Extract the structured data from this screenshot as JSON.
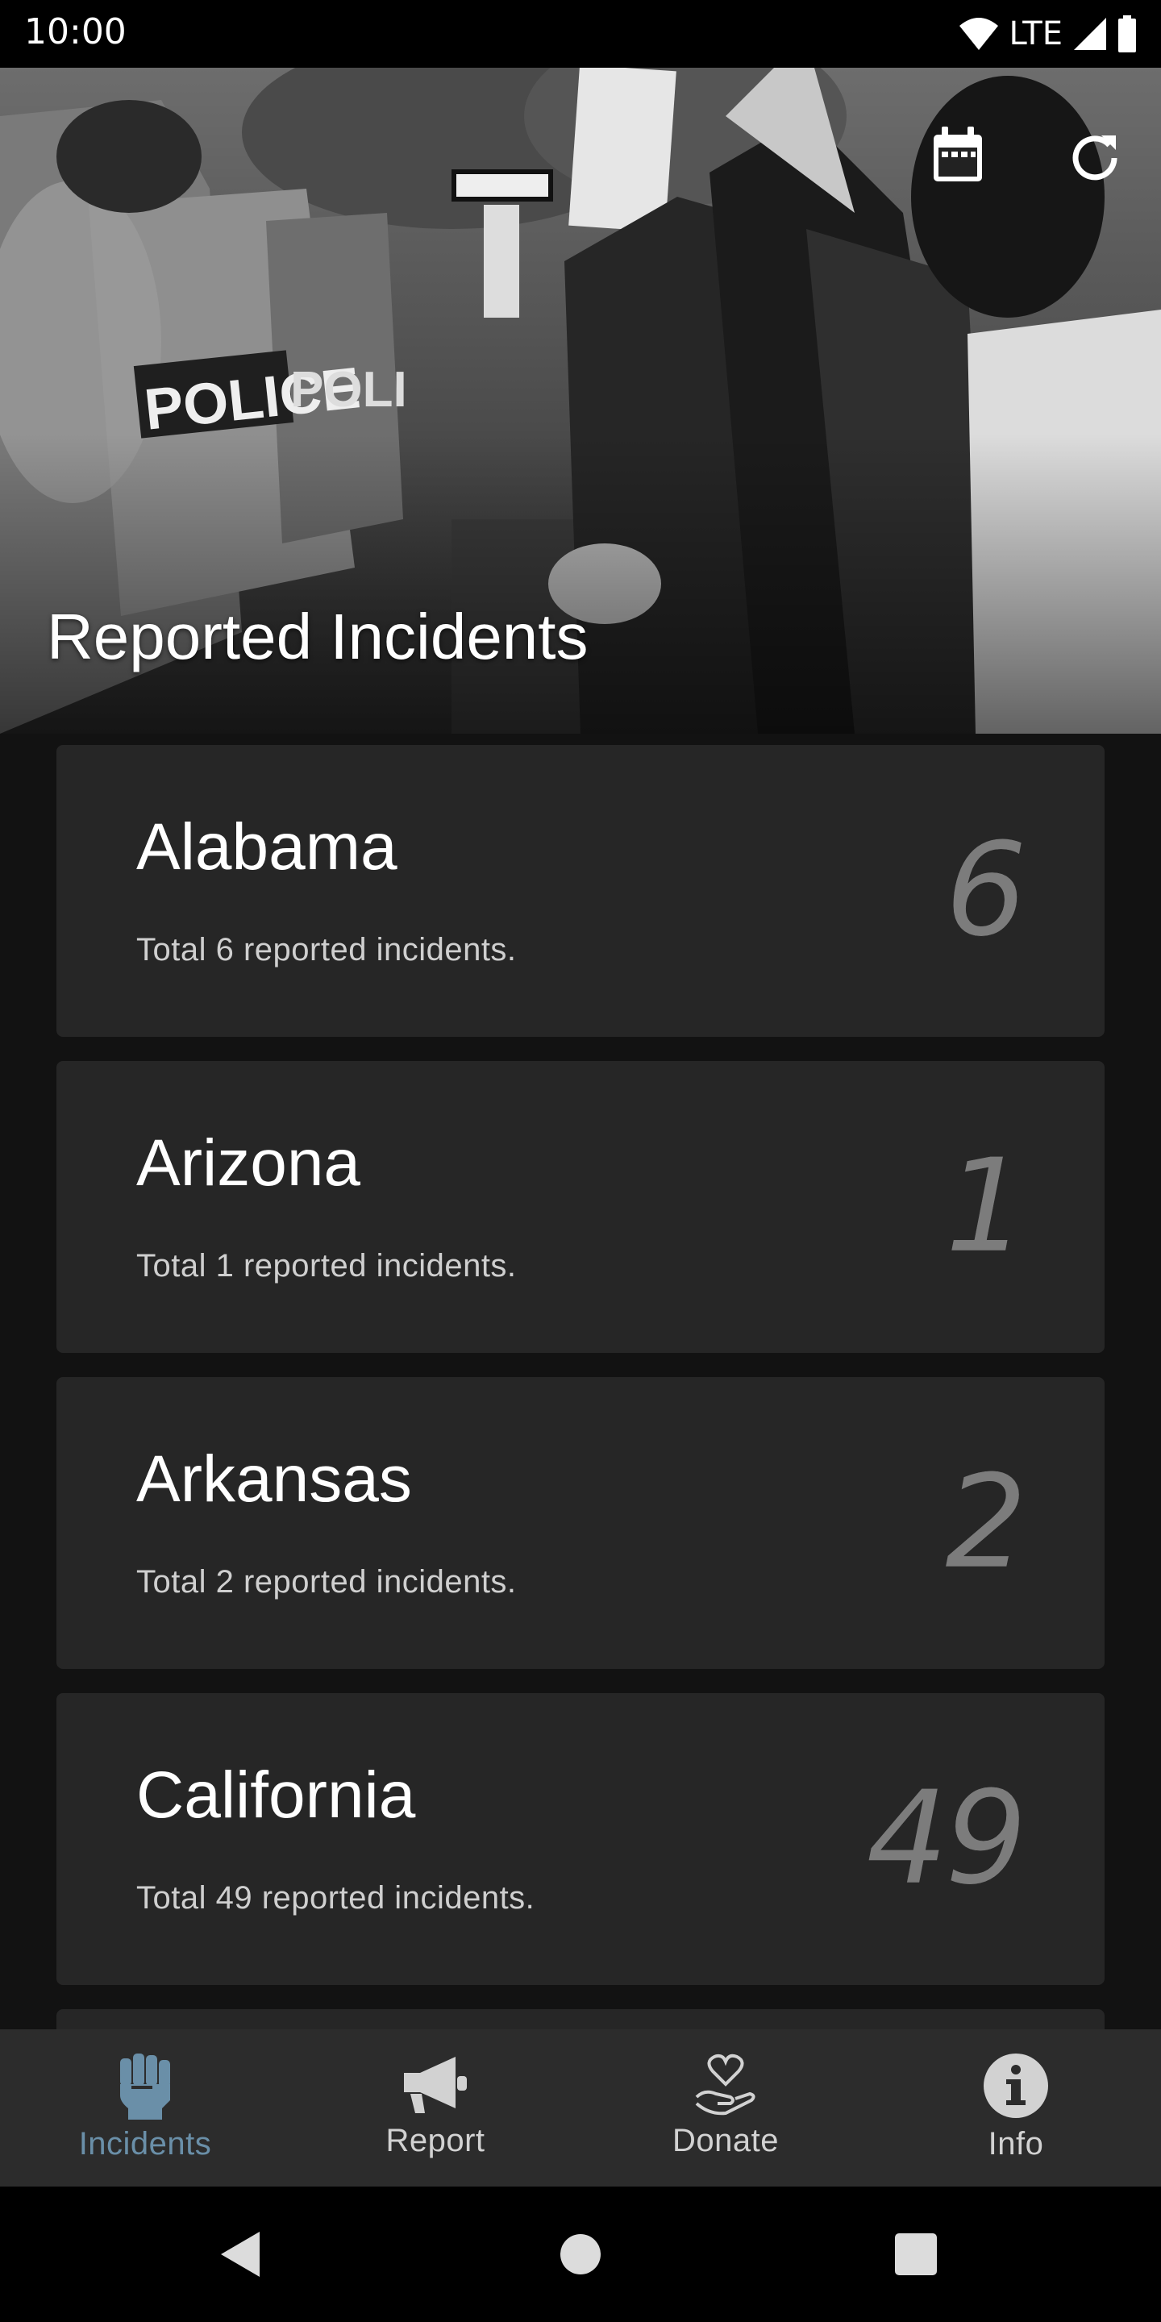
{
  "status_bar": {
    "time": "10:00",
    "network": "LTE",
    "icons": [
      "wifi-icon",
      "signal-icon",
      "battery-icon"
    ]
  },
  "header": {
    "title": "Reported Incidents",
    "actions": [
      "calendar-icon",
      "refresh-icon"
    ],
    "background": "protest-photo-grayscale"
  },
  "incidents": [
    {
      "state": "Alabama",
      "description": "Total 6 reported incidents.",
      "count": "6"
    },
    {
      "state": "Arizona",
      "description": "Total 1 reported incidents.",
      "count": "1"
    },
    {
      "state": "Arkansas",
      "description": "Total 2 reported incidents.",
      "count": "2"
    },
    {
      "state": "California",
      "description": "Total 49 reported incidents.",
      "count": "49"
    }
  ],
  "bottom_nav": {
    "active": "Incidents",
    "items": [
      {
        "label": "Incidents",
        "icon": "raised-fist-icon"
      },
      {
        "label": "Report",
        "icon": "megaphone-icon"
      },
      {
        "label": "Donate",
        "icon": "hand-heart-icon"
      },
      {
        "label": "Info",
        "icon": "info-icon"
      }
    ]
  },
  "colors": {
    "background": "#121212",
    "card": "#262626",
    "nav_bar": "#2c2c2c",
    "active_nav": "#6a8fa8",
    "count_text": "#8c8c8c"
  }
}
